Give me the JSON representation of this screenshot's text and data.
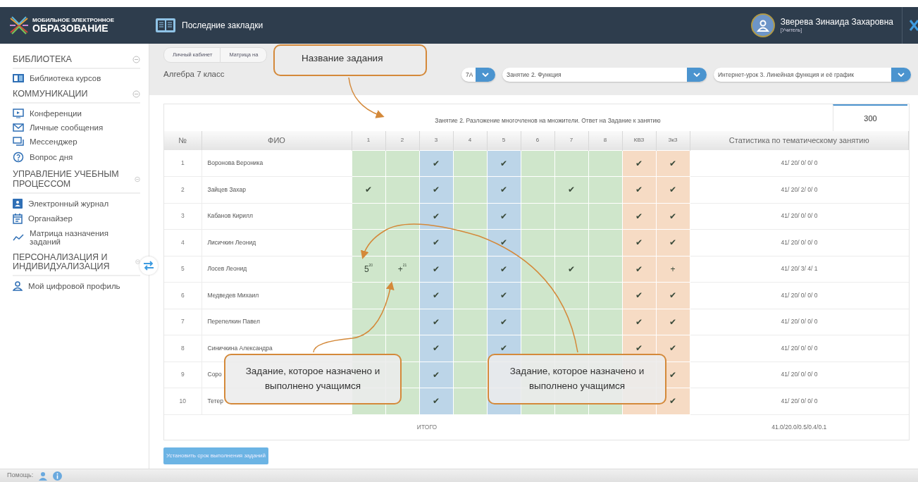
{
  "header": {
    "logo_top": "МОБИЛЬНОЕ ЭЛЕКТРОННОЕ",
    "logo_bottom": "ОБРАЗОВАНИЕ",
    "bookmarks": "Последние закладки",
    "user_name": "Зверева Зинаида Захаровна",
    "user_role": "[Учитель]"
  },
  "sidebar": {
    "sections": [
      {
        "title": "БИБЛИОТЕКА",
        "items": [
          {
            "label": "Библиотека курсов"
          }
        ]
      },
      {
        "title": "КОММУНИКАЦИИ",
        "items": [
          {
            "label": "Конференции"
          },
          {
            "label": "Личные сообщения"
          },
          {
            "label": "Мессенджер"
          },
          {
            "label": "Вопрос дня"
          }
        ]
      },
      {
        "title": "УПРАВЛЕНИЕ УЧЕБНЫМ ПРОЦЕССОМ",
        "items": [
          {
            "label": "Электронный журнал"
          },
          {
            "label": "Органайзер"
          },
          {
            "label": "Матрица назначения заданий"
          }
        ]
      },
      {
        "title": "ПЕРСОНАЛИЗАЦИЯ И ИНДИВИДУАЛИЗАЦИЯ",
        "items": [
          {
            "label": "Мой цифровой профиль"
          }
        ]
      }
    ]
  },
  "breadcrumb": [
    {
      "label": "Личный кабинет"
    },
    {
      "label": "Матрица на"
    }
  ],
  "subject": "Алгебра 7 класс",
  "selects": [
    {
      "value": "7А"
    },
    {
      "value": "Занятие 2. Функция"
    },
    {
      "value": "Интернет-урок 3. Линейная функция и её график"
    }
  ],
  "table": {
    "title": "Занятие 2. Разложение многочленов на множители. Ответ на Задание к занятию",
    "score": "300",
    "number_header": "№",
    "name_header": "ФИО",
    "stats_header": "Статистика по тематическому занятию",
    "mark_columns": [
      {
        "label": "1",
        "color": "#cfe6cb"
      },
      {
        "label": "2",
        "color": "#cfe6cb"
      },
      {
        "label": "3",
        "color": "#bcd5e8"
      },
      {
        "label": "4",
        "color": "#cfe6cb"
      },
      {
        "label": "5",
        "color": "#bcd5e8"
      },
      {
        "label": "6",
        "color": "#cfe6cb"
      },
      {
        "label": "7",
        "color": "#cfe6cb"
      },
      {
        "label": "8",
        "color": "#cfe6cb"
      },
      {
        "label": "КВЗ",
        "color": "#f6dbc4"
      },
      {
        "label": "ЗкЗ",
        "color": "#f6dbc4"
      }
    ],
    "rows": [
      {
        "number": "1",
        "name": "Воронова Вероника",
        "cells": [
          "",
          "",
          "✔",
          "",
          "✔",
          "",
          "",
          "",
          "✔",
          "✔"
        ],
        "stats": "41/ 20/ 0/ 0/ 0"
      },
      {
        "number": "2",
        "name": "Зайцев Захар",
        "cells": [
          "✔",
          "",
          "✔",
          "",
          "✔",
          "",
          "✔",
          "",
          "✔",
          "✔"
        ],
        "stats": "41/ 20/ 2/ 0/ 0"
      },
      {
        "number": "3",
        "name": "Кабанов Кирилл",
        "cells": [
          "",
          "",
          "✔",
          "",
          "✔",
          "",
          "",
          "",
          "✔",
          "✔"
        ],
        "stats": "41/ 20/ 0/ 0/ 0"
      },
      {
        "number": "4",
        "name": "Лисичкин Леонид",
        "cells": [
          "",
          "",
          "✔",
          "",
          "✔",
          "",
          "",
          "",
          "✔",
          "✔"
        ],
        "stats": "41/ 20/ 0/ 0/ 0"
      },
      {
        "number": "5",
        "name": "Лосев Леонид",
        "cells": [
          "5$^{20}$",
          "+$^{21}$",
          "✔",
          "",
          "✔",
          "",
          "✔",
          "",
          "✔",
          "+"
        ],
        "stats": "41/ 20/ 3/ 4/ 1"
      },
      {
        "number": "6",
        "name": "Медведев Михаил",
        "cells": [
          "",
          "",
          "✔",
          "",
          "✔",
          "",
          "",
          "",
          "✔",
          "✔"
        ],
        "stats": "41/ 20/ 0/ 0/ 0"
      },
      {
        "number": "7",
        "name": "Перепелкин Павел",
        "cells": [
          "",
          "",
          "✔",
          "",
          "✔",
          "",
          "",
          "",
          "✔",
          "✔"
        ],
        "stats": "41/ 20/ 0/ 0/ 0"
      },
      {
        "number": "8",
        "name": "Синичкина Александра",
        "cells": [
          "",
          "",
          "✔",
          "",
          "✔",
          "",
          "",
          "",
          "✔",
          "✔"
        ],
        "stats": "41/ 20/ 0/ 0/ 0"
      },
      {
        "number": "9",
        "name": "Соро",
        "cells": [
          "",
          "",
          "✔",
          "",
          "",
          "",
          "",
          "",
          "",
          "✔"
        ],
        "stats": "41/ 20/ 0/ 0/ 0"
      },
      {
        "number": "10",
        "name": "Тетер",
        "cells": [
          "",
          "",
          "✔",
          "",
          "",
          "",
          "",
          "",
          "",
          "✔"
        ],
        "stats": "41/ 20/ 0/ 0/ 0"
      }
    ],
    "total_label": "ИТОГО",
    "total_stats": "41.0/20.0/0.5/0.4/0.1"
  },
  "set_deadline_button": "Установить срок выполнения заданий",
  "footer": {
    "help_label": "Помощь:"
  },
  "annotations": [
    {
      "text": "Название задания"
    },
    {
      "text": "Задание, которое назначено и выполнено учащимся"
    },
    {
      "text": "Задание, которое назначено и выполнено учащимся"
    }
  ]
}
